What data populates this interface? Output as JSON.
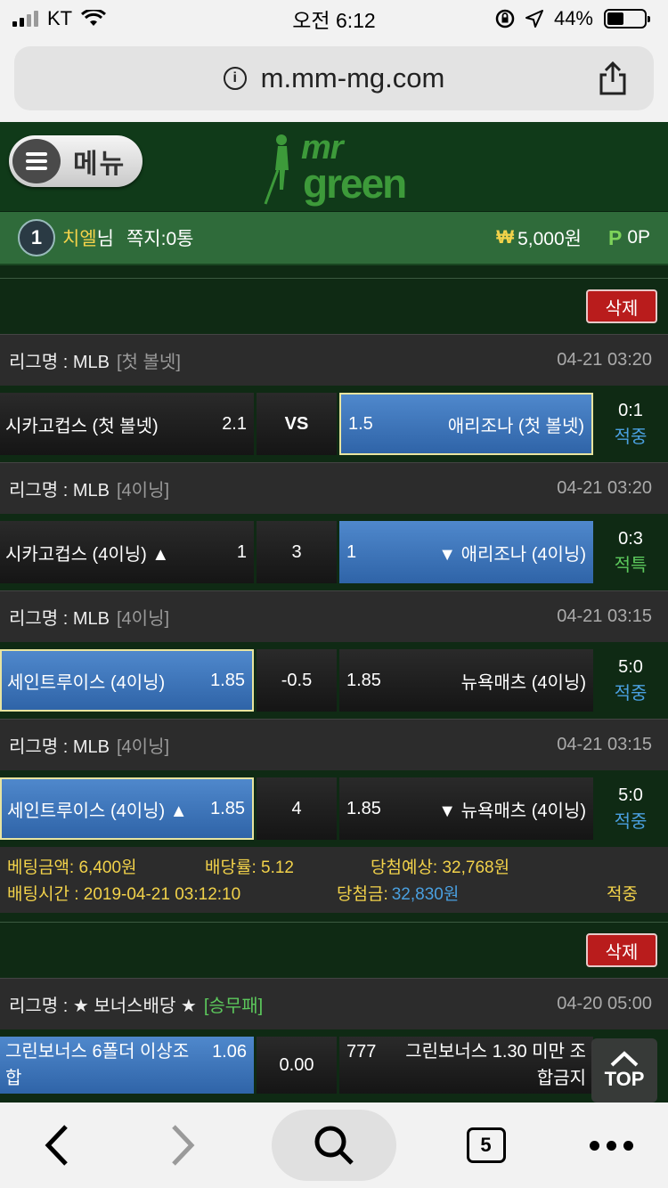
{
  "status": {
    "carrier": "KT",
    "time": "오전 6:12",
    "battery": "44%",
    "battery_level": 0.44
  },
  "browser": {
    "url": "m.mm-mg.com"
  },
  "header": {
    "menu_label": "메뉴",
    "logo_top": "mr",
    "logo_bottom": "green"
  },
  "user": {
    "level": "1",
    "name": "치엘",
    "suffix": "님",
    "note": "쪽지:0통",
    "won_symbol": "₩",
    "balance": "5,000원",
    "point_symbol": "P",
    "points": "0P"
  },
  "slips": [
    {
      "delete_label": "삭제",
      "games": [
        {
          "league": "리그명 : MLB",
          "tag": "[첫 볼넷]",
          "time": "04-21 03:20",
          "home": "시카고컵스 (첫 볼넷)",
          "home_odds": "2.1",
          "mid": "VS",
          "away_odds": "1.5",
          "away": "애리조나 (첫 볼넷)",
          "score": "0:1",
          "result": "적중"
        },
        {
          "league": "리그명 : MLB",
          "tag": "[4이닝]",
          "time": "04-21 03:20",
          "home": "시카고컵스 (4이닝) ▲",
          "home_odds": "1",
          "mid": "3",
          "away_odds": "1",
          "away": "▼ 애리조나 (4이닝)",
          "score": "0:3",
          "result": "적특"
        },
        {
          "league": "리그명 : MLB",
          "tag": "[4이닝]",
          "time": "04-21 03:15",
          "home": "세인트루이스 (4이닝)",
          "home_odds": "1.85",
          "mid": "-0.5",
          "away_odds": "1.85",
          "away": "뉴욕매츠 (4이닝)",
          "score": "5:0",
          "result": "적중"
        },
        {
          "league": "리그명 : MLB",
          "tag": "[4이닝]",
          "time": "04-21 03:15",
          "home": "세인트루이스 (4이닝) ▲",
          "home_odds": "1.85",
          "mid": "4",
          "away_odds": "1.85",
          "away": "▼ 뉴욕매츠 (4이닝)",
          "score": "5:0",
          "result": "적중"
        }
      ],
      "summary": {
        "bet_amount": "베팅금액: 6,400원",
        "odds": "배당률: 5.12",
        "expected": "당첨예상: 32,768원",
        "bet_time": "배팅시간 : 2019-04-21 03:12:10",
        "win_label": "당첨금:",
        "win_amount": "32,830원",
        "status": "적중"
      }
    },
    {
      "delete_label": "삭제",
      "games": [
        {
          "league": "리그명 : ★ 보너스배당 ★",
          "tag": "[승무패]",
          "time": "04-20 05:00",
          "home": "그린보너스 6폴더 이상조합",
          "home_odds": "1.06",
          "mid": "0.00",
          "away_odds": "777",
          "away": "그린보너스 1.30 미만 조합금지",
          "score": "",
          "result": ""
        }
      ]
    }
  ],
  "top_button": "TOP",
  "toolbar": {
    "tab_count": "5"
  }
}
